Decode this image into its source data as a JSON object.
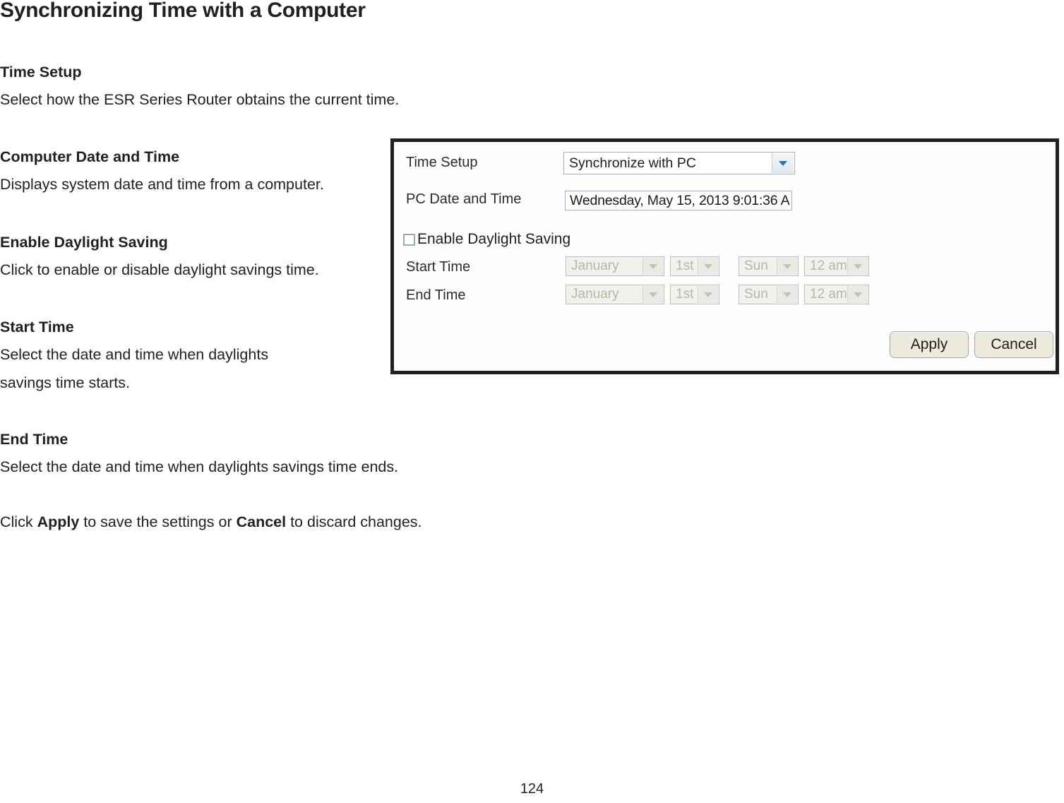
{
  "document": {
    "title": "Synchronizing Time with a Computer",
    "page_number": "124",
    "sections": [
      {
        "heading": "Time Setup",
        "body": "Select how the ESR Series Router obtains the current time."
      },
      {
        "heading": "Computer Date and Time",
        "body": "Displays system date and time from a computer."
      },
      {
        "heading": "Enable Daylight Saving",
        "body": "Click to enable or disable daylight savings time."
      },
      {
        "heading": "Start Time",
        "body_line1": "Select the date and time when daylights",
        "body_line2": "savings time starts."
      },
      {
        "heading": "End Time",
        "body": "Select the date and time when daylights savings time ends."
      }
    ],
    "footer_note": {
      "prefix": "Click ",
      "bold1": "Apply",
      "middle": " to save the settings or ",
      "bold2": "Cancel",
      "suffix": " to discard changes."
    }
  },
  "screenshot": {
    "rows": {
      "time_setup": {
        "label": "Time Setup",
        "value": "Synchronize with PC"
      },
      "pc_date_and_time": {
        "label": "PC Date and Time",
        "value": "Wednesday, May 15, 2013 9:01:36 A"
      },
      "enable_daylight_saving": {
        "label": "Enable Daylight Saving",
        "checked": false
      },
      "start_time": {
        "label": "Start Time",
        "month": "January",
        "day": "1st",
        "weekday": "Sun",
        "hour": "12 am"
      },
      "end_time": {
        "label": "End Time",
        "month": "January",
        "day": "1st",
        "weekday": "Sun",
        "hour": "12 am"
      }
    },
    "buttons": {
      "apply": "Apply",
      "cancel": "Cancel"
    },
    "colors": {
      "panel_border": "#231f20",
      "select_arrow": "#2f6ea8",
      "button_face": "#edeade"
    }
  }
}
